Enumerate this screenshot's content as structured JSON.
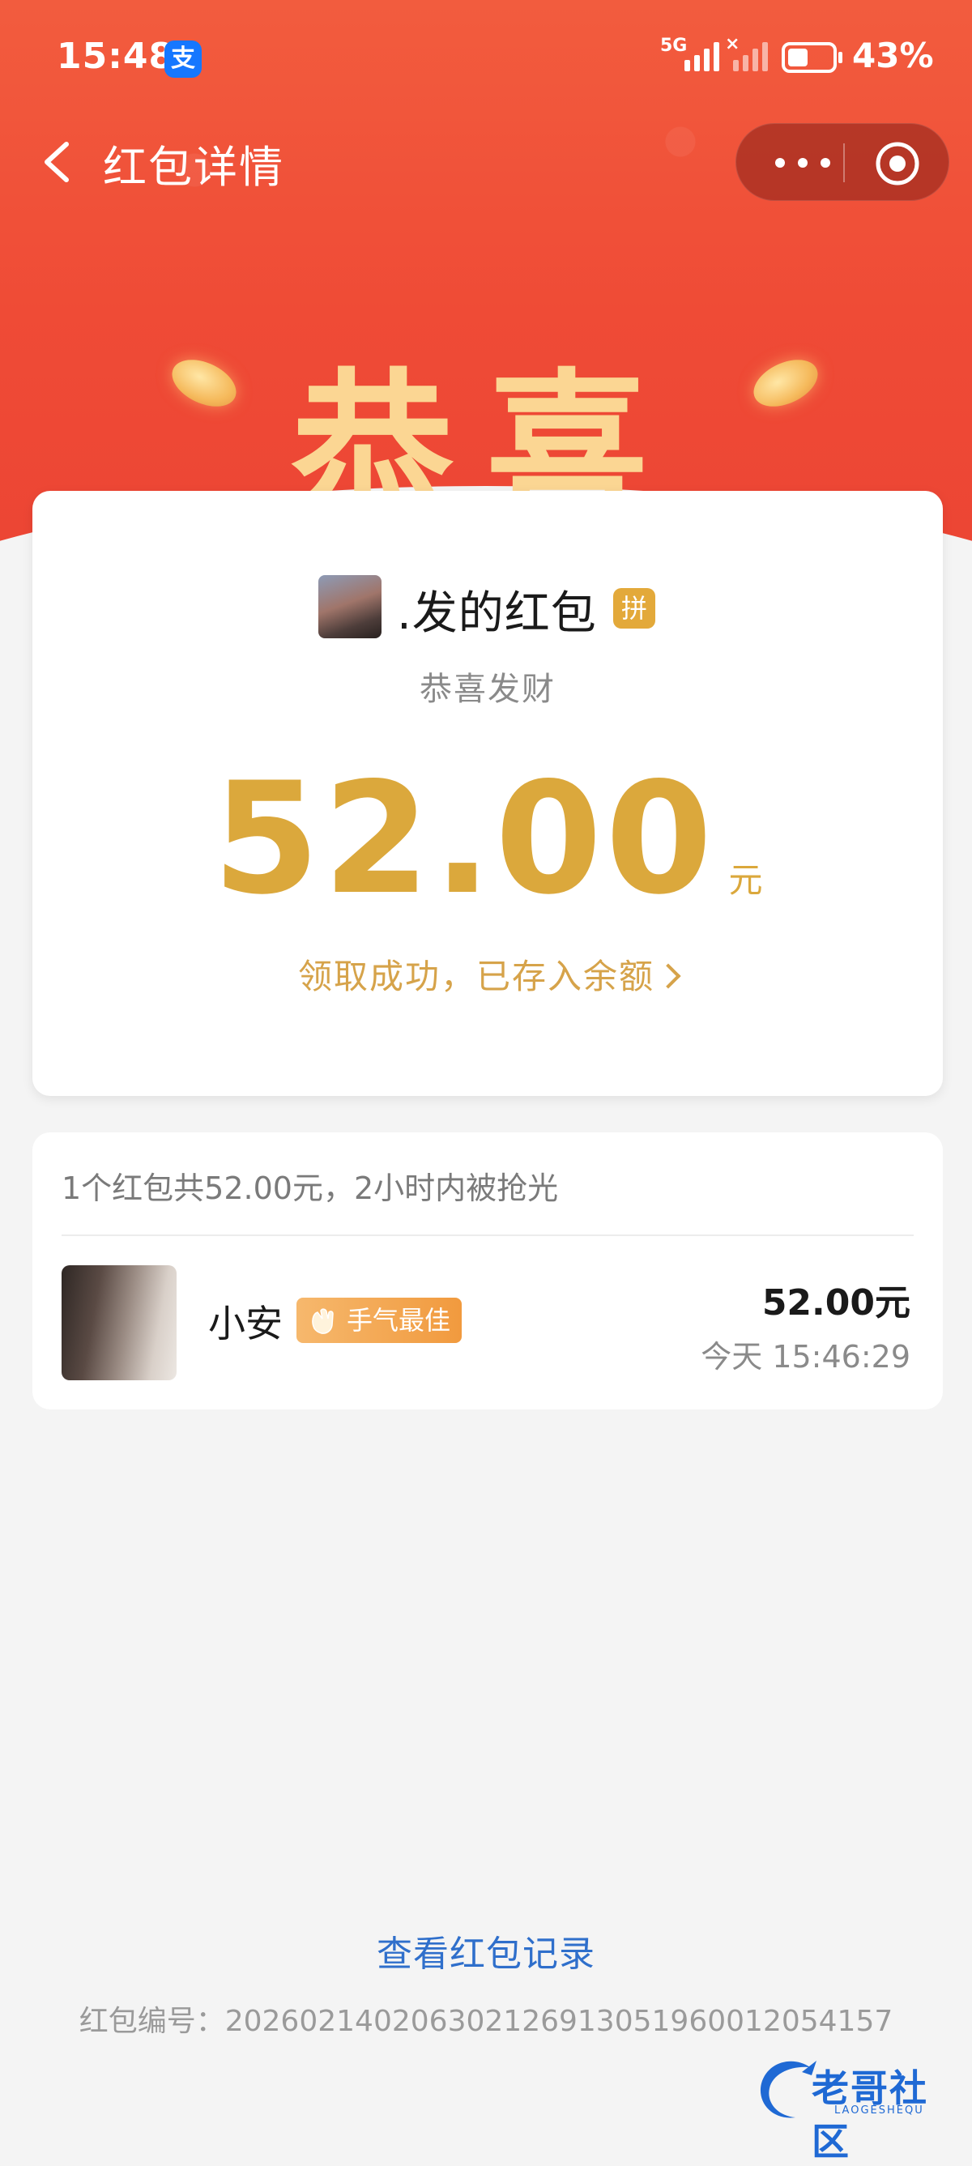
{
  "status_bar": {
    "time": "15:48",
    "app_badge": "支",
    "network": "5G",
    "battery": "43%"
  },
  "header": {
    "title": "红包详情",
    "back_icon": "chevron-left-icon",
    "more_icon": "more-horizontal-icon",
    "close_icon": "target-circle-icon"
  },
  "banner": {
    "big_text": "恭喜"
  },
  "packet": {
    "sender": ".发的红包",
    "type_badge": "拼",
    "blessing": "恭喜发财",
    "amount": "52.00",
    "unit": "元",
    "status_link": "领取成功，已存入余额"
  },
  "records": {
    "summary": "1个红包共52.00元，2小时内被抢光",
    "items": [
      {
        "name": "小安",
        "badge": "手气最佳",
        "amount": "52.00元",
        "time": "今天 15:46:29"
      }
    ]
  },
  "footer": {
    "history_link": "查看红包记录",
    "serial_label": "红包编号：",
    "serial_number": "20260214020630212691305196001205415​7"
  },
  "watermark": {
    "text": "老哥社区",
    "sub": "LAOGESHEQU"
  },
  "colors": {
    "header_red": "#ef4b36",
    "gold": "#dba83c",
    "link_blue": "#2f6fcb",
    "badge_orange": "#f19a3e"
  }
}
